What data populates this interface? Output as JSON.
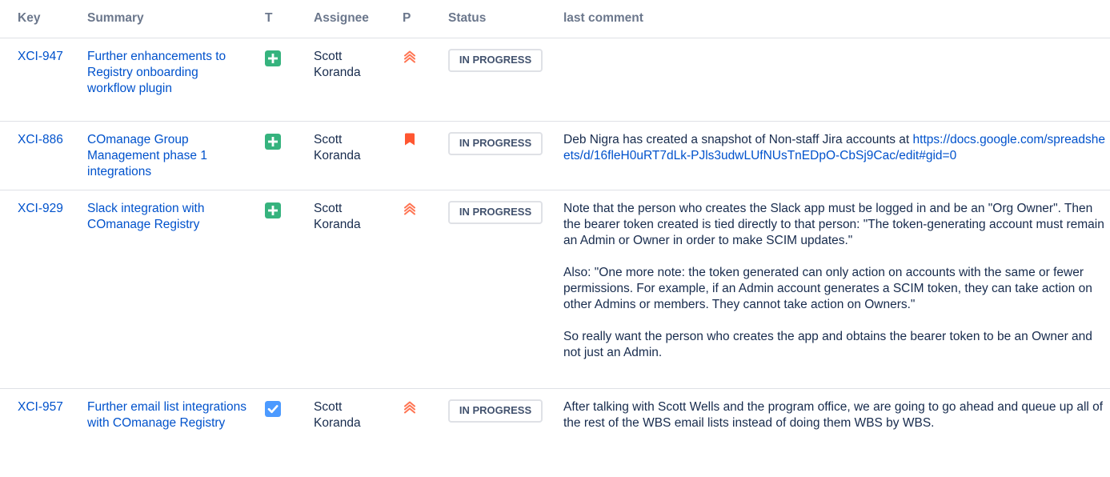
{
  "headers": {
    "key": "Key",
    "summary": "Summary",
    "type": "T",
    "assignee": "Assignee",
    "priority": "P",
    "status": "Status",
    "last_comment": "last comment"
  },
  "colors": {
    "link": "#0052cc",
    "header_text": "#6b778c",
    "new_feature": "#36b37e",
    "task": "#4c9aff",
    "priority_high": "#ff7452",
    "priority_highest": "#ff5630"
  },
  "rows": [
    {
      "key": "XCI-947",
      "summary": "Further enhancements to Registry onboarding workflow plugin",
      "type_icon": "new-feature-icon",
      "assignee": "Scott Koranda",
      "priority_icon": "priority-high-icon",
      "status": "IN PROGRESS",
      "comment": {
        "paragraphs": []
      }
    },
    {
      "key": "XCI-886",
      "summary": "COmanage Group Management phase 1 integrations",
      "type_icon": "new-feature-icon",
      "assignee": "Scott Koranda",
      "priority_icon": "priority-highest-icon",
      "status": "IN PROGRESS",
      "comment": {
        "text": "Deb Nigra has created a snapshot of Non-staff Jira accounts at ",
        "link": "https://docs.google.com/spreadsheets/d/16fleH0uRT7dLk-PJls3udwLUfNUsTnEDpO-CbSj9Cac/edit#gid=0"
      }
    },
    {
      "key": "XCI-929",
      "summary": "Slack integration with COmanage Registry",
      "type_icon": "new-feature-icon",
      "assignee": "Scott Koranda",
      "priority_icon": "priority-high-icon",
      "status": "IN PROGRESS",
      "comment": {
        "paragraphs": [
          "Note that the person who creates the Slack app must be logged in and be an \"Org Owner\". Then the bearer token created is tied directly to that person: \"The token-generating account must remain an Admin or Owner in order to make SCIM updates.\"",
          "Also: \"One more note: the token generated can only action on accounts with the same or fewer permissions. For example, if an Admin account generates a SCIM token, they can take action on other Admins or members. They cannot take action on Owners.\"",
          "So really want the person who creates the app and obtains the bearer token to be an Owner and not just an Admin."
        ]
      }
    },
    {
      "key": "XCI-957",
      "summary": "Further email list integrations with COmanage Registry",
      "type_icon": "task-icon",
      "assignee": "Scott Koranda",
      "priority_icon": "priority-high-icon",
      "status": "IN PROGRESS",
      "comment": {
        "paragraphs": [
          "After talking with Scott Wells and the program office, we are going to go ahead and queue up all of the rest of the WBS email lists instead of doing them WBS by WBS."
        ]
      }
    }
  ]
}
